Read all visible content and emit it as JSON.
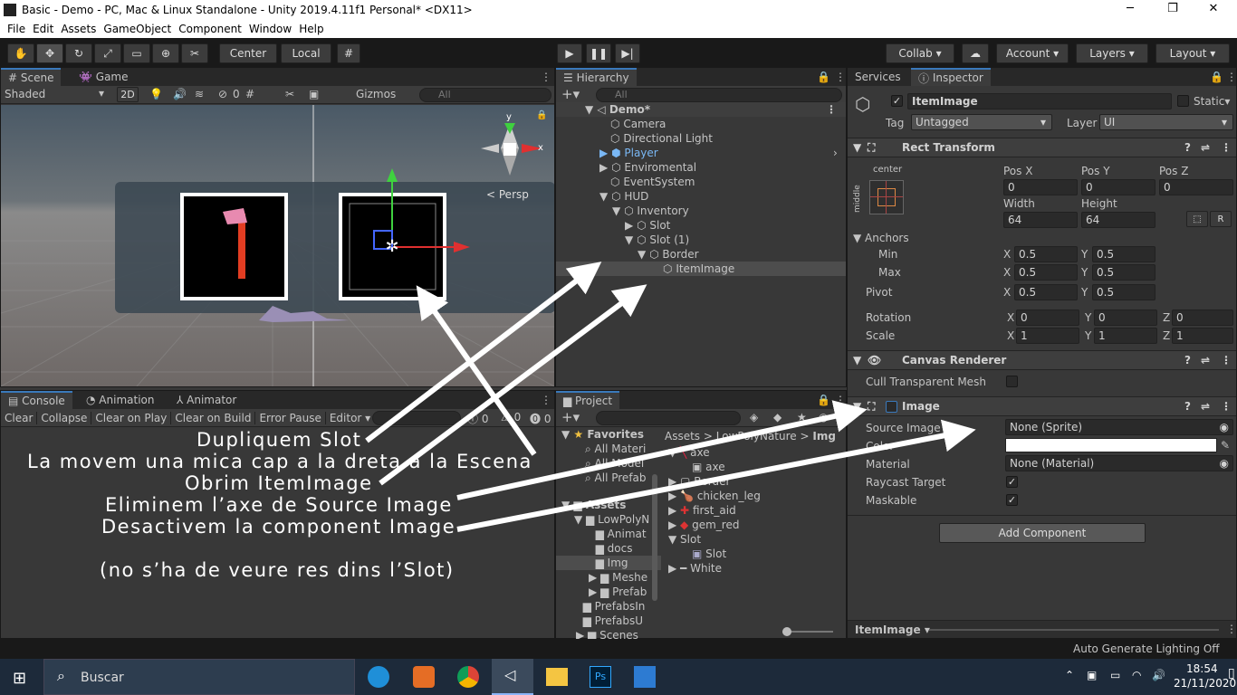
{
  "window": {
    "title": "Basic - Demo - PC, Mac & Linux Standalone - Unity 2019.4.11f1 Personal* <DX11>",
    "minimize": "─",
    "restore": "❐",
    "close": "✕"
  },
  "menu": [
    "File",
    "Edit",
    "Assets",
    "GameObject",
    "Component",
    "Window",
    "Help"
  ],
  "toolbar": {
    "pivot_center": "Center",
    "pivot_local": "Local",
    "collab": "Collab ▾",
    "account": "Account",
    "layers": "Layers",
    "layout": "Layout"
  },
  "scene_panel": {
    "tab_scene": "Scene",
    "tab_game": "Game",
    "shading": "Shaded",
    "mode_2d": "2D",
    "gizmo_count": "0",
    "gizmos": "Gizmos",
    "search_placeholder": "All",
    "persp": "Persp",
    "axis_x": "x",
    "axis_y": "y"
  },
  "hierarchy": {
    "tab": "Hierarchy",
    "search_placeholder": "All",
    "items": [
      {
        "label": "Demo*",
        "depth": 0,
        "arrow": "▼"
      },
      {
        "label": "Camera",
        "depth": 1,
        "arrow": ""
      },
      {
        "label": "Directional Light",
        "depth": 1,
        "arrow": ""
      },
      {
        "label": "Player",
        "depth": 1,
        "arrow": "▶"
      },
      {
        "label": "Enviromental",
        "depth": 1,
        "arrow": "▶"
      },
      {
        "label": "EventSystem",
        "depth": 1,
        "arrow": ""
      },
      {
        "label": "HUD",
        "depth": 1,
        "arrow": "▼"
      },
      {
        "label": "Inventory",
        "depth": 2,
        "arrow": "▼"
      },
      {
        "label": "Slot",
        "depth": 3,
        "arrow": "▶"
      },
      {
        "label": "Slot (1)",
        "depth": 3,
        "arrow": "▼"
      },
      {
        "label": "Border",
        "depth": 4,
        "arrow": "▼"
      },
      {
        "label": "ItemImage",
        "depth": 5,
        "arrow": ""
      }
    ]
  },
  "console": {
    "tab_console": "Console",
    "tab_animation": "Animation",
    "tab_animator": "Animator",
    "clear": "Clear",
    "collapse": "Collapse",
    "clear_on_play": "Clear on Play",
    "clear_on_build": "Clear on Build",
    "error_pause": "Error Pause",
    "editor": "Editor",
    "count_log": "0",
    "count_warn": "0",
    "count_err": "0"
  },
  "project": {
    "tab": "Project",
    "breadcrumb": [
      "Assets",
      "LowPolyNature",
      "Img"
    ],
    "favorites_label": "Favorites",
    "favorites": [
      "All Materi",
      "All Model",
      "All Prefab"
    ],
    "assets_label": "Assets",
    "tree": [
      "LowPolyN",
      "Animat",
      "docs",
      "Img",
      "Meshe",
      "Prefab",
      "PrefabsIn",
      "PrefabsU",
      "Scenes"
    ],
    "files": [
      "axe",
      "axe",
      "Border",
      "chicken_leg",
      "first_aid",
      "gem_red",
      "Slot",
      "Slot",
      "White"
    ]
  },
  "inspector": {
    "tab_services": "Services",
    "tab_inspector": "Inspector",
    "object_name": "ItemImage",
    "static_label": "Static",
    "tag_label": "Tag",
    "tag_value": "Untagged",
    "layer_label": "Layer",
    "layer_value": "UI",
    "rect_transform": {
      "title": "Rect Transform",
      "anchor_h": "center",
      "anchor_v": "middle",
      "pos_x_label": "Pos X",
      "pos_y_label": "Pos Y",
      "pos_z_label": "Pos Z",
      "pos_x": "0",
      "pos_y": "0",
      "pos_z": "0",
      "width_label": "Width",
      "height_label": "Height",
      "width": "64",
      "height": "64",
      "anchors_label": "Anchors",
      "min_label": "Min",
      "max_label": "Max",
      "min_x": "0.5",
      "min_y": "0.5",
      "max_x": "0.5",
      "max_y": "0.5",
      "pivot_label": "Pivot",
      "pivot_x": "0.5",
      "pivot_y": "0.5",
      "rotation_label": "Rotation",
      "rot_x": "0",
      "rot_y": "0",
      "rot_z": "0",
      "scale_label": "Scale",
      "scale_x": "1",
      "scale_y": "1",
      "scale_z": "1",
      "x": "X",
      "y": "Y",
      "z": "Z",
      "r_btn": "R"
    },
    "canvas_renderer": {
      "title": "Canvas Renderer",
      "cull_label": "Cull Transparent Mesh"
    },
    "image": {
      "title": "Image",
      "source_label": "Source Image",
      "source_value": "None (Sprite)",
      "color_label": "Color",
      "material_label": "Material",
      "material_value": "None (Material)",
      "raycast_label": "Raycast Target",
      "maskable_label": "Maskable"
    },
    "add_component": "Add Component",
    "footer_name": "ItemImage ▾"
  },
  "status": {
    "lighting": "Auto Generate Lighting Off"
  },
  "taskbar": {
    "search_placeholder": "Buscar",
    "time": "18:54",
    "date": "21/11/2020"
  },
  "annotations": [
    "Dupliquem Slot",
    "La movem una mica cap a la dreta a la Escena",
    "Obrim ItemImage",
    "Eliminem l’axe de Source Image",
    "Desactivem la component Image",
    "(no s’ha de veure res dins l’Slot)"
  ],
  "colors": {
    "accent": "#3a79bb",
    "panel": "#383838",
    "dark": "#191919",
    "field": "#2a2a2a",
    "taskbar": "#1d2a3a"
  }
}
